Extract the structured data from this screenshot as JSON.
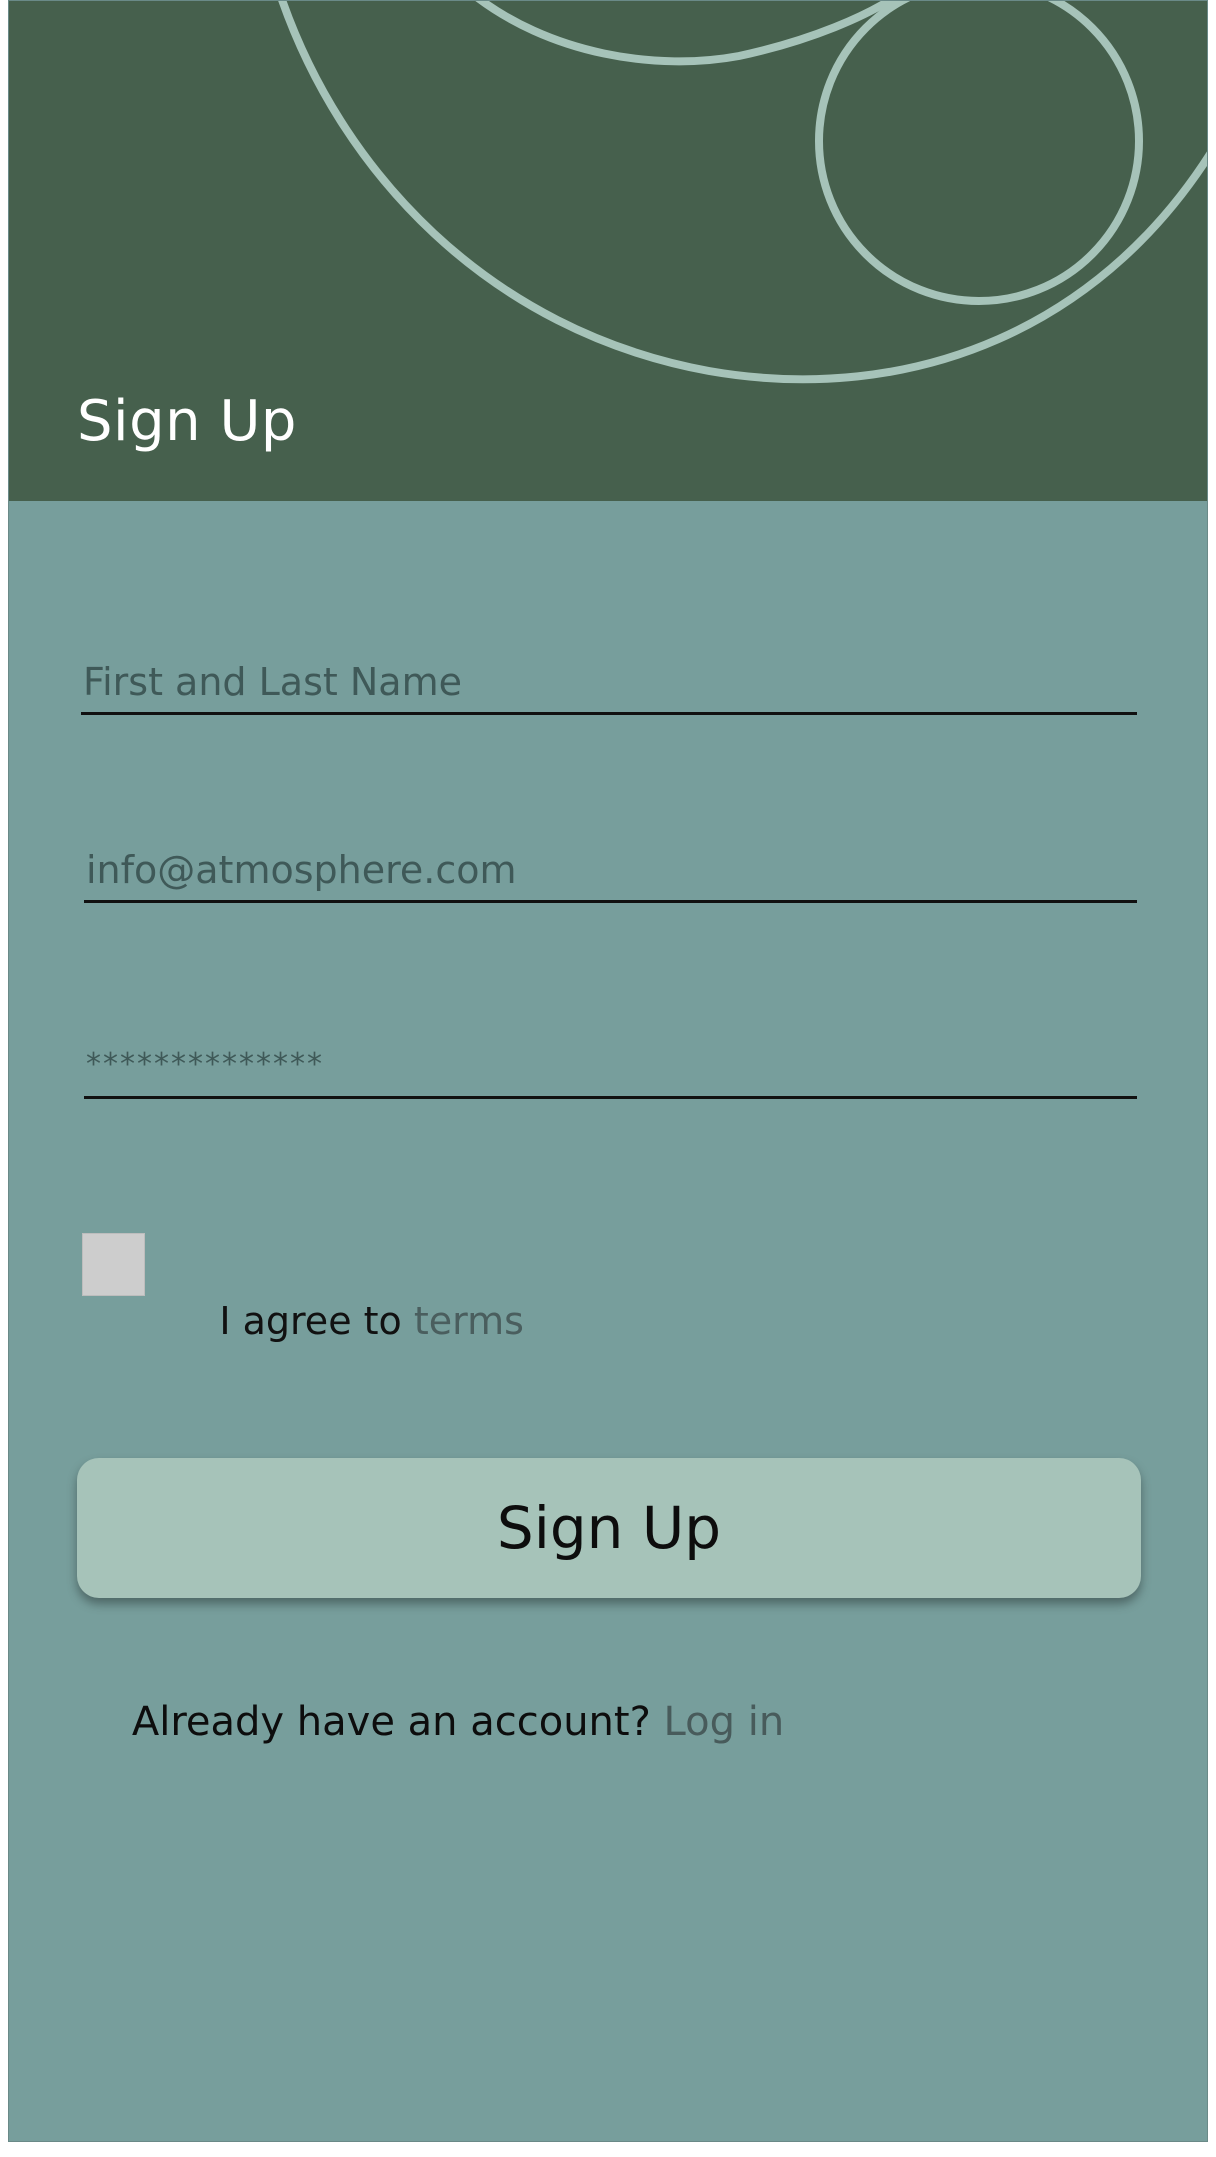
{
  "header": {
    "title": "Sign Up",
    "background_color": "#46604d",
    "decoration_color": "#a6c3b9"
  },
  "form": {
    "name_placeholder": "First and Last Name",
    "email_placeholder": "info@atmosphere.com",
    "password_placeholder": "**************",
    "terms": {
      "checked": false,
      "prefix": "I agree to ",
      "link_label": "terms"
    },
    "submit_label": "Sign Up"
  },
  "footer": {
    "prompt": "Already have an account? ",
    "link_label": "Log in"
  },
  "colors": {
    "page_background": "#779e9c",
    "button_background": "#a6c3b9"
  }
}
